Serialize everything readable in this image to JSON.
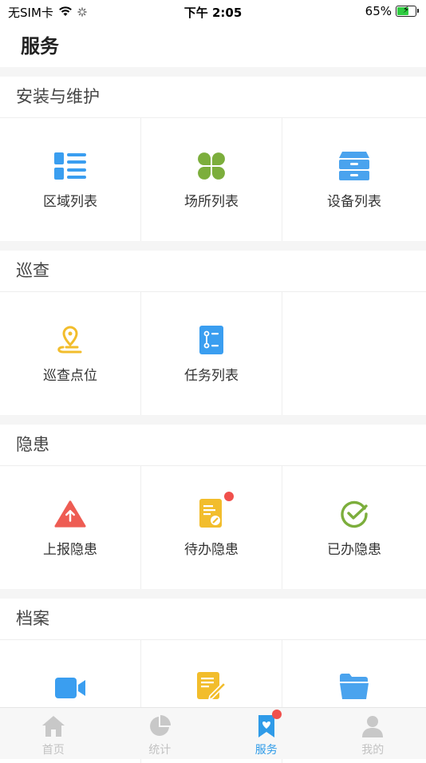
{
  "status_bar": {
    "carrier": "无SIM卡",
    "time": "下午 2:05",
    "battery_percent": "65%",
    "battery_level": 0.65
  },
  "header": {
    "title": "服务"
  },
  "sections": [
    {
      "title": "安装与维护",
      "items": [
        {
          "label": "区域列表",
          "icon": "list-icon",
          "color": "#3a9ef0"
        },
        {
          "label": "场所列表",
          "icon": "clover-icon",
          "color": "#7cae3c"
        },
        {
          "label": "设备列表",
          "icon": "cabinet-icon",
          "color": "#4aa3ee"
        }
      ]
    },
    {
      "title": "巡查",
      "items": [
        {
          "label": "巡查点位",
          "icon": "location-pin-icon",
          "color": "#f2bd2c"
        },
        {
          "label": "任务列表",
          "icon": "task-list-icon",
          "color": "#3a9ef0"
        }
      ]
    },
    {
      "title": "隐患",
      "items": [
        {
          "label": "上报隐患",
          "icon": "warning-upload-icon",
          "color": "#ee5c53"
        },
        {
          "label": "待办隐患",
          "icon": "pending-document-icon",
          "color": "#f2bd2c",
          "badge": true
        },
        {
          "label": "已办隐患",
          "icon": "check-circle-icon",
          "color": "#7cae3c"
        }
      ]
    },
    {
      "title": "档案",
      "items": [
        {
          "label": "",
          "icon": "video-icon",
          "color": "#3a9ef0"
        },
        {
          "label": "",
          "icon": "edit-document-icon",
          "color": "#f2bd2c"
        },
        {
          "label": "",
          "icon": "folder-icon",
          "color": "#4aa3ee"
        }
      ]
    }
  ],
  "tabbar": {
    "items": [
      {
        "label": "首页",
        "icon": "home-icon",
        "active": false
      },
      {
        "label": "统计",
        "icon": "pie-chart-icon",
        "active": false
      },
      {
        "label": "服务",
        "icon": "service-icon",
        "active": true,
        "badge": true
      },
      {
        "label": "我的",
        "icon": "user-icon",
        "active": false
      }
    ]
  },
  "colors": {
    "accent": "#2f9be8",
    "badge": "#f0504c",
    "inactive_tab": "#c2c2c2"
  }
}
